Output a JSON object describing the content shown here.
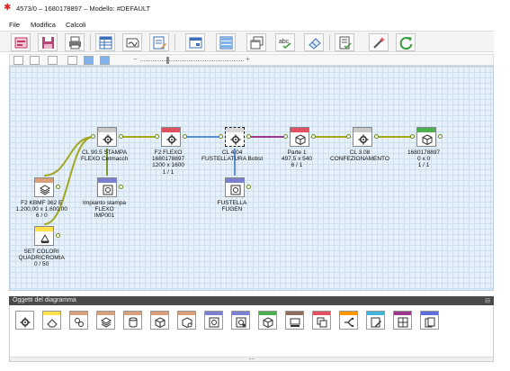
{
  "window": {
    "title": "4573/0 – 1680178897 – Modello: #DEFAULT",
    "app_icon": "star-logo-icon"
  },
  "menu": [
    {
      "label": "File"
    },
    {
      "label": "Modifica"
    },
    {
      "label": "Calcoli"
    }
  ],
  "toolbar": {
    "buttons": [
      {
        "icon": "print-preview-icon"
      },
      {
        "icon": "save-icon"
      },
      {
        "icon": "print-icon"
      },
      {
        "icon": "table-view-icon"
      },
      {
        "icon": "sign-document-icon"
      },
      {
        "icon": "edit-form-icon"
      },
      {
        "icon": "window-icon"
      },
      {
        "icon": "grid-list-icon"
      },
      {
        "icon": "copy-windows-icon"
      },
      {
        "icon": "spell-check-icon",
        "text": "abc"
      },
      {
        "icon": "eraser-icon"
      },
      {
        "icon": "document-check-icon"
      },
      {
        "icon": "magic-wand-icon"
      },
      {
        "icon": "refresh-icon"
      }
    ]
  },
  "diagram_toolbar": {
    "buttons": [
      "page-icon",
      "tree-icon",
      "copy-icon",
      "layout-icon",
      "fit-icon",
      "grid-icon"
    ],
    "zoom": {
      "minus": "−",
      "plus": "+",
      "level": 0.25
    }
  },
  "diagram": {
    "nodes": [
      {
        "id": "stampa",
        "icon": "gear-icon",
        "color": "#c8c8c8",
        "label": [
          "CL 90.5 STAMPA",
          "FLEXO Cetmacch"
        ]
      },
      {
        "id": "flexo",
        "icon": "gear-icon",
        "color": "#e05060",
        "label": [
          "F2 FLEXO",
          "1680178897",
          "1200 x 1600",
          "1 / 1"
        ]
      },
      {
        "id": "fustellatura",
        "icon": "gear-icon",
        "color": "#d8d8d8",
        "label": [
          "CL 4.04",
          "FUSTELLATURA Bobst"
        ]
      },
      {
        "id": "parte",
        "icon": "box-icon",
        "color": "#e05060",
        "label": [
          "Parte 1",
          "497,5 x 540",
          "6 / 1"
        ]
      },
      {
        "id": "confezionamento",
        "icon": "gear-icon",
        "color": "#c8c8c8",
        "label": [
          "CL 3.08",
          "CONFEZIONAMENTO"
        ]
      },
      {
        "id": "prodotto",
        "icon": "box-icon",
        "color": "#4caf50",
        "label": [
          "1680178897",
          "0 x 0",
          "1 / 1"
        ]
      },
      {
        "id": "carta",
        "icon": "stack-icon",
        "color": "#d9a07c",
        "label": [
          "F2 KBMF 362 E",
          "1.200,00 x 1.600,00",
          "6 / 0"
        ]
      },
      {
        "id": "impianto",
        "icon": "plate-icon",
        "color": "#7a7fd0",
        "label": [
          "Impianto stampa",
          "FLEXO",
          "IMP001"
        ]
      },
      {
        "id": "fustella",
        "icon": "plate-icon",
        "color": "#7a7fd0",
        "label": [
          "FUSTELLA",
          "FUGEN"
        ]
      },
      {
        "id": "colori",
        "icon": "ink-icon",
        "color": "#ffe14d",
        "label": [
          "SET COLORI",
          "QUADRICROMIA",
          "0 / 50"
        ]
      }
    ],
    "links": [
      {
        "from": "carta",
        "to": "stampa",
        "color": "#a3a61f"
      },
      {
        "from": "colori",
        "to": "stampa",
        "color": "#a3a61f"
      },
      {
        "from": "impianto",
        "to": "stampa",
        "color": "#7c9a2e"
      },
      {
        "from": "stampa",
        "to": "flexo",
        "color": "#a3a61f"
      },
      {
        "from": "flexo",
        "to": "fustellatura",
        "color": "#5b8fd8"
      },
      {
        "from": "fustella",
        "to": "fustellatura",
        "color": "#5b8fd8"
      },
      {
        "from": "fustellatura",
        "to": "parte",
        "color": "#9b3a8c"
      },
      {
        "from": "parte",
        "to": "confezionamento",
        "color": "#a3a61f"
      },
      {
        "from": "confezionamento",
        "to": "prodotto",
        "color": "#a3a61f"
      }
    ]
  },
  "panel": {
    "title": "Oggetti del diagramma",
    "pin": "⊟",
    "items": [
      {
        "icon": "gear-icon",
        "color": "#ffffff"
      },
      {
        "icon": "eraser-icon",
        "color": "#ffe14d"
      },
      {
        "icon": "circles-icon",
        "color": "#d9a07c"
      },
      {
        "icon": "stack-icon",
        "color": "#d9a07c"
      },
      {
        "icon": "cylinder-icon",
        "color": "#d9a07c"
      },
      {
        "icon": "box-icon",
        "color": "#d9a07c"
      },
      {
        "icon": "box-gear-icon",
        "color": "#d9a07c"
      },
      {
        "icon": "plate-icon",
        "color": "#7a7fd0"
      },
      {
        "icon": "plate-gear-icon",
        "color": "#7a7fd0"
      },
      {
        "icon": "box-icon",
        "color": "#4caf50"
      },
      {
        "icon": "pallet-icon",
        "color": "#8d6e5a"
      },
      {
        "icon": "layers-icon",
        "color": "#e05060"
      },
      {
        "icon": "split-icon",
        "color": "#ff9800"
      },
      {
        "icon": "pencil-note-icon",
        "color": "#3fb6d8"
      },
      {
        "icon": "grid-box-icon",
        "color": "#9b3a8c"
      },
      {
        "icon": "documents-icon",
        "color": "#5b6fd8"
      }
    ]
  }
}
